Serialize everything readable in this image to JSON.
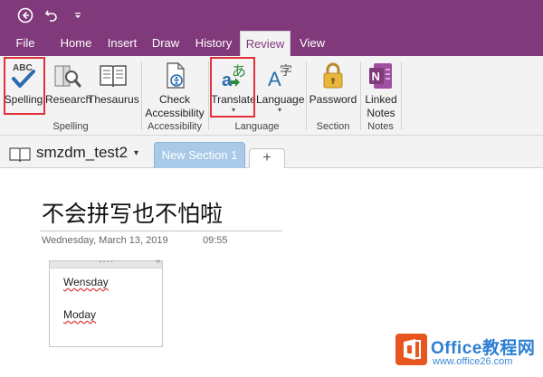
{
  "quick_access": {
    "back_icon": "back-circle-icon",
    "undo_icon": "undo-icon",
    "customize_icon": "qat-customize-icon"
  },
  "tabs": [
    {
      "label": "File"
    },
    {
      "label": "Home"
    },
    {
      "label": "Insert"
    },
    {
      "label": "Draw"
    },
    {
      "label": "History"
    },
    {
      "label": "Review",
      "active": true
    },
    {
      "label": "View"
    }
  ],
  "ribbon": {
    "spelling": {
      "label": "Spelling",
      "icon": "abc-check-icon"
    },
    "research": {
      "label": "Research",
      "icon": "research-icon"
    },
    "thesaurus": {
      "label": "Thesaurus",
      "icon": "thesaurus-book-icon"
    },
    "check_accessibility": {
      "label_line1": "Check",
      "label_line2": "Accessibility",
      "icon": "accessibility-icon"
    },
    "translate": {
      "label": "Translate",
      "caret": "▾",
      "icon": "translate-icon"
    },
    "language": {
      "label": "Language",
      "caret": "▾",
      "icon": "language-icon"
    },
    "password": {
      "label": "Password",
      "icon": "padlock-icon"
    },
    "linked_notes": {
      "label_line1": "Linked",
      "label_line2": "Notes",
      "icon": "onenote-linked-notes-icon"
    },
    "groups": {
      "spelling": "Spelling",
      "accessibility": "Accessibility",
      "language": "Language",
      "section": "Section",
      "notes": "Notes"
    }
  },
  "notebook": {
    "name": "smzdm_test2",
    "caret": "▾",
    "section_tab": "New Section 1",
    "add_tab": "+"
  },
  "page": {
    "title": "不会拼写也不怕啦",
    "date": "Wednesday, March 13, 2019",
    "time": "09:55",
    "note": {
      "dots": "····",
      "arrows": "‹›",
      "lines": [
        "Wensday",
        "Moday"
      ]
    }
  },
  "watermark": {
    "title": "Office教程网",
    "url": "www.office26.com"
  },
  "colors": {
    "onenote_purple": "#80397b",
    "ribbon_bg": "#f3f3f3",
    "highlight_red": "#e2313b",
    "section_tab_blue": "#a9c9e8",
    "watermark_orange": "#e8561f",
    "watermark_blue": "#2d7fd3"
  }
}
